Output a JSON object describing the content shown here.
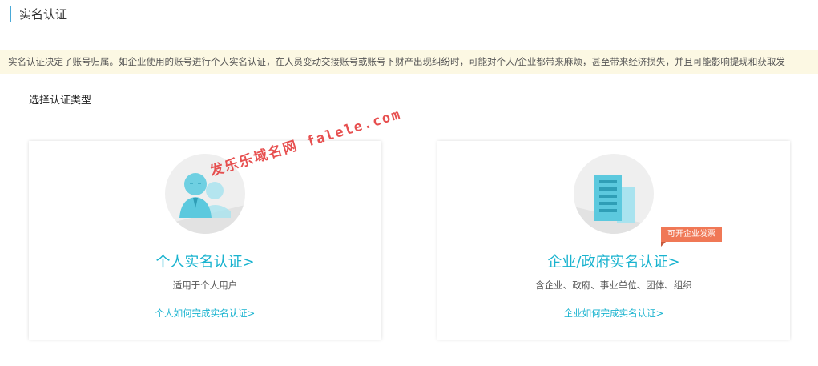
{
  "header": {
    "title": "实名认证"
  },
  "notice": {
    "text": "实名认证决定了账号归属。如企业使用的账号进行个人实名认证，在人员变动交接账号或账号下财产出现纠纷时，可能对个人/企业都带来麻烦，甚至带来经济损失，并且可能影响提现和获取发"
  },
  "section": {
    "title": "选择认证类型"
  },
  "cards": [
    {
      "title": "个人实名认证>",
      "description": "适用于个人用户",
      "link": "个人如何完成实名认证>",
      "icon": "person-icon"
    },
    {
      "title": "企业/政府实名认证>",
      "description": "含企业、政府、事业单位、团体、组织",
      "link": "企业如何完成实名认证>",
      "icon": "building-icon",
      "badge": "可开企业发票"
    }
  ],
  "watermark": "发乐乐域名网 falele.com",
  "colors": {
    "accent": "#19b3cf",
    "notice_bg": "#fcf8e3",
    "badge": "#f07856",
    "header_bar": "#49a9d8"
  }
}
